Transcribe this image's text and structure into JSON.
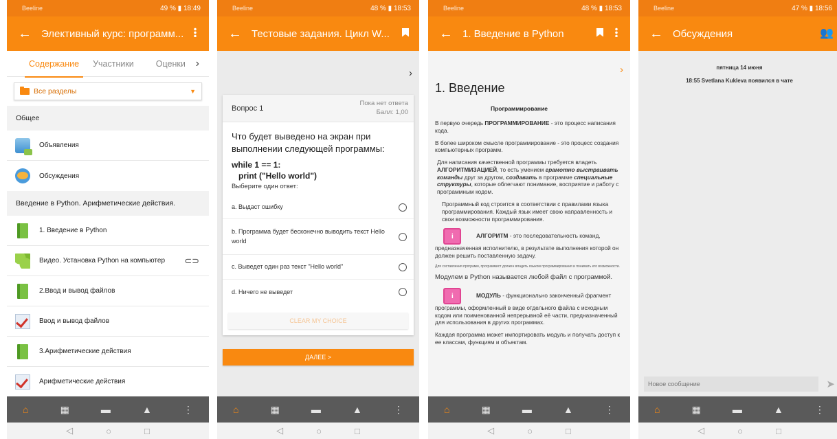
{
  "common": {
    "carrier": "Beeline",
    "nav_back": "◁",
    "nav_home": "○",
    "nav_recent": "□"
  },
  "s1": {
    "battery": "49 %",
    "time": "18:49",
    "title": "Элективный курс: программ...",
    "tabs": [
      "Содержание",
      "Участники",
      "Оценки"
    ],
    "section_select": "Все разделы",
    "group1": "Общее",
    "items1": [
      "Объявления",
      "Обсуждения"
    ],
    "group2": "Введение в Python. Арифметические действия.",
    "items2": [
      "1. Введение в Python",
      "Видео. Установка Python на компьютер",
      "2.Ввод и вывод файлов",
      "Ввод и вывод файлов",
      "3.Арифметические действия",
      "Арифметические действия"
    ]
  },
  "s2": {
    "battery": "48 %",
    "time": "18:53",
    "title": "Тестовые задания. Цикл W...",
    "question_no": "Вопрос 1",
    "status": "Пока нет ответа",
    "grade": "Балл: 1,00",
    "question": "Что будет выведено на экран при выполнении следующей программы:",
    "code_line1": "while 1 == 1:",
    "code_line2": "print (\"Hello world\")",
    "prompt": "Выберите один ответ:",
    "options": [
      "a. Выдаст ошибку",
      "b. Программа будет бесконечно выводить текст Hello world",
      "c. Выведет один раз текст \"Hello world\"",
      "d. Ничего не выведет"
    ],
    "clear": "CLEAR MY CHOICE",
    "next": "ДАЛЕЕ >"
  },
  "s3": {
    "battery": "48 %",
    "time": "18:53",
    "title": "1. Введение в Python",
    "heading": "1. Введение",
    "subheading": "Программирование",
    "p1_pre": "В первую очередь ",
    "p1_b": "ПРОГРАММИРОВАНИЕ",
    "p1_post": " - это процесс написания кода.",
    "p2": "В более широком смысле программирование - это процесс создания компьютерных программ.",
    "p3_a": "Для написания качественной программы требуется владеть ",
    "p3_b": "АЛГОРИТМИЗАЦИЕЙ",
    "p3_c": ", то есть умением ",
    "p3_d": "грамотно выстраивать команды",
    "p3_e": " друг за другом, ",
    "p3_f": "создавать",
    "p3_g": " в программе ",
    "p3_h": "специальные структуры",
    "p3_i": ", которые облегчают понимание, восприятие и работу с программным кодом.",
    "p4": "Программный код строится в соответствии с правилами языка программирования. Каждый язык имеет свою направленность и свои возможности программирования.",
    "algo_b": "АЛГОРИТМ",
    "algo_text": " - это последовательность команд, предназначенная исполнителю, в результате выполнения которой он должен решить поставленную задачу.",
    "tiny": "Для составления программ, программист должен владеть языком программирования и понимать его возможности.",
    "module_intro": "Модулем в Python называется любой файл с программой.",
    "module_b": "МОДУЛЬ",
    "module_text": " - функционально законченный фрагмент программы, оформленный в виде отдельного файла с исходным кодом или поименованной непрерывной её части, предназначенный для использования в других программах.",
    "last": "Каждая программа может импортировать модуль и получать доступ к ее классам, функциям и объектам."
  },
  "s4": {
    "battery": "47 %",
    "time": "18:56",
    "title": "Обсуждения",
    "date": "пятница 14 июня",
    "event": "18:55 Svetlana Kukleva появился в чате",
    "placeholder": "Новое сообщение"
  }
}
